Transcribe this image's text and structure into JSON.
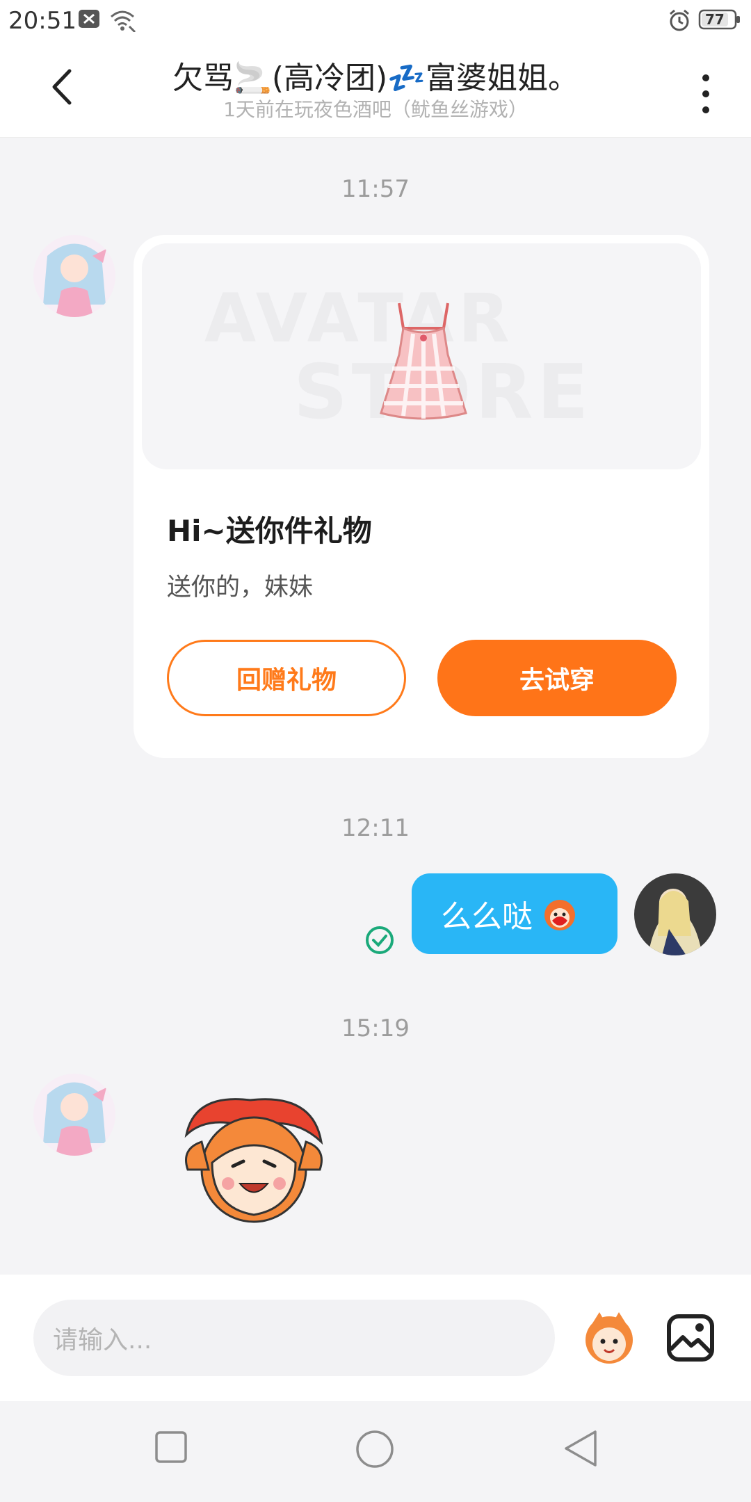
{
  "status_bar": {
    "time": "20:51",
    "battery": "77"
  },
  "header": {
    "title": "欠骂🚬(高冷团)💤富婆姐姐。",
    "subtitle": "1天前在玩夜色酒吧（鱿鱼丝游戏）"
  },
  "messages": [
    {
      "timestamp": "11:57",
      "card": {
        "watermark_line1": "AVATAR",
        "watermark_line2": "STORE",
        "title": "Hi~送你件礼物",
        "desc": "送你的，妹妹",
        "return_gift_label": "回赠礼物",
        "try_on_label": "去试穿"
      }
    },
    {
      "timestamp": "12:11",
      "text": "么么哒"
    },
    {
      "timestamp": "15:19"
    }
  ],
  "composer": {
    "placeholder": "请输入..."
  },
  "colors": {
    "accent_orange": "#ff7418",
    "bubble_blue": "#29b6f6",
    "read_check": "#1aa97a"
  },
  "icons": [
    "back-arrow-icon",
    "more-vertical-icon",
    "sticker-mascot-icon",
    "image-gallery-icon",
    "nav-square-icon",
    "nav-circle-icon",
    "nav-triangle-icon"
  ]
}
